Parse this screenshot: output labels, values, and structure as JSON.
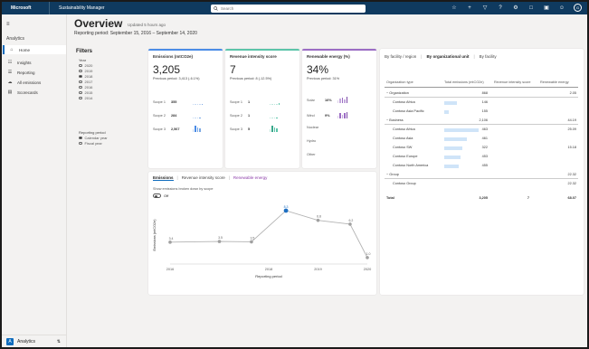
{
  "topbar": {
    "brand": "Microsoft",
    "app_name": "Sustainability Manager",
    "search_placeholder": "Search",
    "avatar_initials": "G",
    "icons": [
      "lightbulb-icon",
      "plus-icon",
      "filter-icon",
      "help-icon",
      "settings-icon",
      "chat-icon",
      "present-icon",
      "person-icon"
    ]
  },
  "sidebar": {
    "group_label": "Analytics",
    "items": [
      {
        "label": "Home",
        "icon": "home-icon",
        "active": true
      },
      {
        "label": "Insights",
        "icon": "chart-icon",
        "active": false
      },
      {
        "label": "Reporting",
        "icon": "report-icon",
        "active": false
      },
      {
        "label": "All emissions",
        "icon": "cloud-icon",
        "active": false
      },
      {
        "label": "Scorecards",
        "icon": "scorecard-icon",
        "active": false
      }
    ],
    "footer_badge": "A",
    "footer_label": "Analytics"
  },
  "header": {
    "title": "Overview",
    "subtitle": "Updated 5 hours ago",
    "period": "Reporting period: September 15, 2016 – September 14, 2020"
  },
  "filters": {
    "title": "Filters",
    "year_label": "Year",
    "years": [
      {
        "label": "2020",
        "selected": false
      },
      {
        "label": "2019",
        "selected": false
      },
      {
        "label": "2018",
        "selected": true
      },
      {
        "label": "2017",
        "selected": false
      },
      {
        "label": "2016",
        "selected": false
      },
      {
        "label": "2015",
        "selected": false
      },
      {
        "label": "2014",
        "selected": false
      }
    ],
    "period_label": "Reporting period",
    "periods": [
      {
        "label": "Calendar year",
        "selected": true
      },
      {
        "label": "Fiscal year",
        "selected": false
      }
    ]
  },
  "kpis": [
    {
      "title": "Emissions (mtCO2e)",
      "accent": "#4b8ce6",
      "value": "3,205",
      "previous": "Previous period: 3,413 (-6.1%)",
      "rows": [
        {
          "label": "Scope 1",
          "value": "355"
        },
        {
          "label": "Scope 2",
          "value": "284"
        },
        {
          "label": "Scope 3",
          "value": "2,567"
        }
      ]
    },
    {
      "title": "Revenue intensity score",
      "accent": "#5cc4a9",
      "value": "7",
      "previous": "Previous period: 8 (-12.5%)",
      "rows": [
        {
          "label": "Scope 1",
          "value": "1"
        },
        {
          "label": "Scope 2",
          "value": "1"
        },
        {
          "label": "Scope 3",
          "value": "5"
        }
      ]
    },
    {
      "title": "Renewable energy (%)",
      "accent": "#9b6cc4",
      "value": "34%",
      "previous": "Previous period: 31%",
      "rows": [
        {
          "label": "Solar",
          "value": "16%"
        },
        {
          "label": "Wind",
          "value": "9%"
        },
        {
          "label": "Nuclear",
          "value": ""
        },
        {
          "label": "Hydro",
          "value": ""
        },
        {
          "label": "Other",
          "value": ""
        }
      ]
    }
  ],
  "trend": {
    "tabs": [
      "Emissions",
      "Revenue intensity score",
      "Renewable energy"
    ],
    "toggle_label": "Show emissions broken down by scope",
    "toggle_state": "Off",
    "chart_data": {
      "type": "line",
      "x": [
        "2016",
        "2017",
        "2018",
        "2019",
        "2020"
      ],
      "points": [
        {
          "x": 2016.0,
          "y": 3400,
          "label": "3.4"
        },
        {
          "x": 2017.0,
          "y": 3500,
          "label": "3.5"
        },
        {
          "x": 2017.65,
          "y": 3450,
          "label": "3.5"
        },
        {
          "x": 2018.35,
          "y": 8300,
          "label": "8.3"
        },
        {
          "x": 2019.0,
          "y": 6800,
          "label": "6.8"
        },
        {
          "x": 2019.65,
          "y": 6200,
          "label": "6.2"
        },
        {
          "x": 2020.0,
          "y": 1000,
          "label": "1.0"
        }
      ],
      "xlabel": "Reporting period",
      "ylabel": "Emissions (mtCO2e)",
      "x_ticks": [
        "2016",
        "2018",
        "2019",
        "2020"
      ],
      "ylim": [
        0,
        9000
      ],
      "colors": {
        "line": "#b3b3b3",
        "point": "#a0a0a0",
        "highlight": "#1d6fc2"
      },
      "highlight_index": 3
    }
  },
  "breakdown": {
    "tabs": [
      "By facility / region",
      "By organizational unit",
      "By facility"
    ],
    "columns": [
      "Organization type",
      "Total emissions (mtCO2e)",
      "Revenue intensity score",
      "Renewable energy"
    ],
    "rows": [
      {
        "name": "Organization",
        "emissions": "868",
        "intensity": "",
        "renewable": "2.05",
        "bar": 0,
        "indent": 0,
        "group": true
      },
      {
        "name": "Contoso Africa",
        "emissions": "146",
        "intensity": "",
        "renewable": "",
        "bar": 0.35,
        "indent": 1,
        "group": false
      },
      {
        "name": "Contoso Asia Pacific",
        "emissions": "155",
        "intensity": "",
        "renewable": "",
        "bar": 0.12,
        "indent": 1,
        "group": false
      },
      {
        "name": "Business",
        "emissions": "2,106",
        "intensity": "",
        "renewable": "44.19",
        "bar": 0,
        "indent": 0,
        "group": true
      },
      {
        "name": "Contoso Africa",
        "emissions": "463",
        "intensity": "",
        "renewable": "25.09",
        "bar": 0.95,
        "indent": 1,
        "group": false
      },
      {
        "name": "Contoso Asia",
        "emissions": "461",
        "intensity": "",
        "renewable": "",
        "bar": 0.62,
        "indent": 1,
        "group": false
      },
      {
        "name": "Contoso SW",
        "emissions": "322",
        "intensity": "",
        "renewable": "15.18",
        "bar": 0.5,
        "indent": 1,
        "group": false
      },
      {
        "name": "Contoso Europe",
        "emissions": "453",
        "intensity": "",
        "renewable": "",
        "bar": 0.45,
        "indent": 1,
        "group": false
      },
      {
        "name": "Contoso North America",
        "emissions": "455",
        "intensity": "",
        "renewable": "",
        "bar": 0.4,
        "indent": 1,
        "group": false
      },
      {
        "name": "Group",
        "emissions": "",
        "intensity": "",
        "renewable": "22.32",
        "bar": 0,
        "indent": 0,
        "group": true
      },
      {
        "name": "Contoso Group",
        "emissions": "",
        "intensity": "",
        "renewable": "22.32",
        "bar": 0,
        "indent": 1,
        "group": false
      },
      {
        "name": "Total",
        "emissions": "3,205",
        "intensity": "7",
        "renewable": "68.07",
        "bar": 0,
        "indent": 0,
        "group": false,
        "total": true
      }
    ]
  }
}
